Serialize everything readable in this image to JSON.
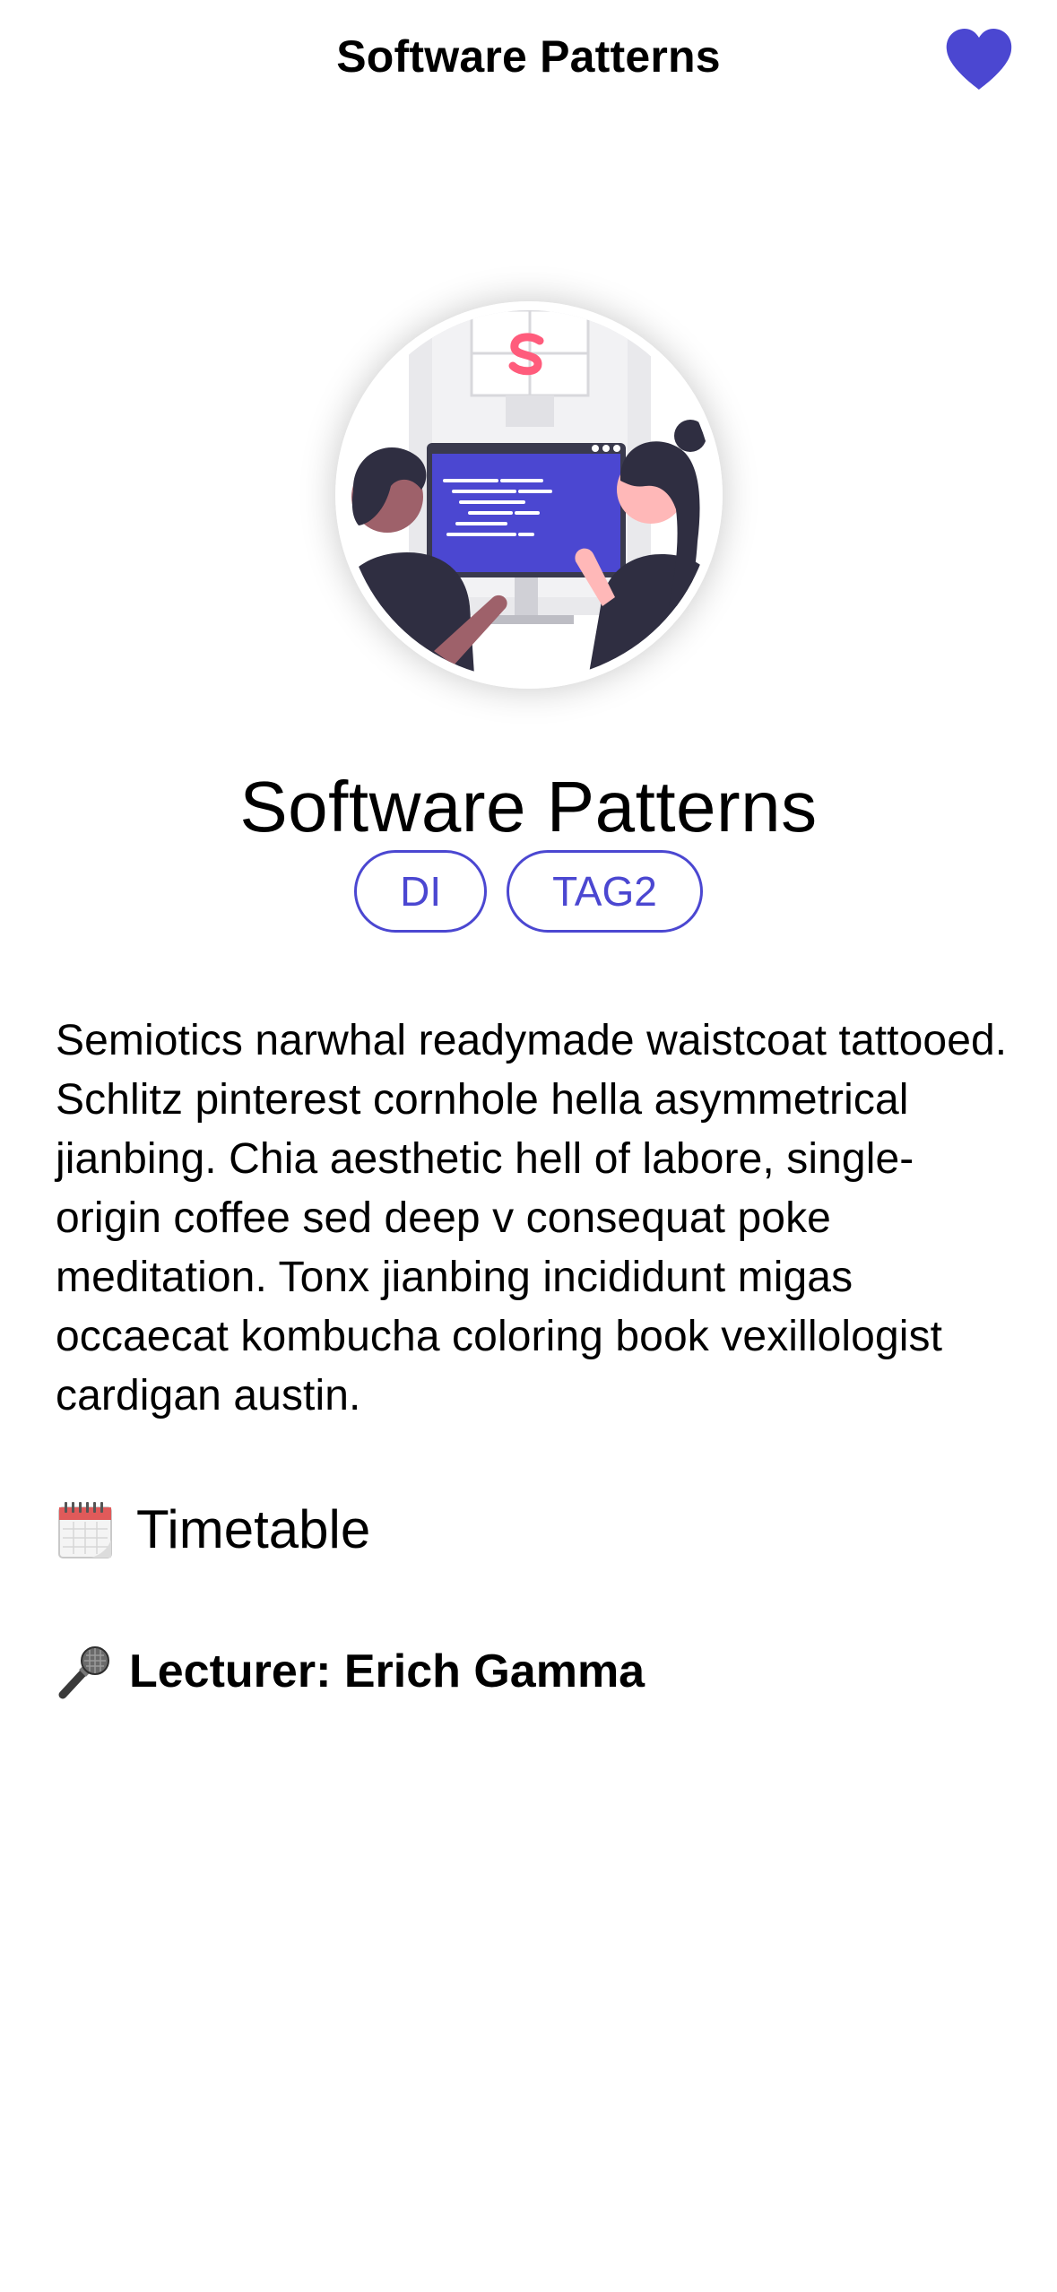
{
  "nav": {
    "title": "Software Patterns",
    "favorite_icon": "heart-icon",
    "accent_color": "#4b47d1"
  },
  "hero": {
    "image": "developers-at-computer-illustration"
  },
  "course": {
    "title": "Software Patterns",
    "tags": [
      "DI",
      "TAG2"
    ],
    "description": "Semiotics narwhal readymade waistcoat tattooed. Schlitz pinterest cornhole hella asymmetrical jianbing. Chia aesthetic hell of labore, single-origin coffee sed deep v consequat poke meditation. Tonx jianbing incididunt migas occaecat kombucha coloring book vexillologist cardigan austin."
  },
  "timetable": {
    "icon": "calendar-icon",
    "label": "Timetable"
  },
  "lecturer": {
    "icon": "microphone-icon",
    "label": "Lecturer: Erich Gamma"
  }
}
